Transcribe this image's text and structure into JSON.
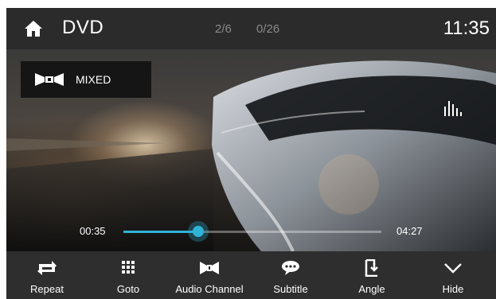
{
  "header": {
    "title": "DVD",
    "track": "2/6",
    "chapter": "0/26",
    "clock": "11:35"
  },
  "audio_badge": {
    "label": "MIXED"
  },
  "playback": {
    "current_time": "00:35",
    "total_time": "04:27",
    "progress": 0.29
  },
  "controls": [
    {
      "label": "Repeat",
      "icon": "repeat-icon"
    },
    {
      "label": "Goto",
      "icon": "grid-icon"
    },
    {
      "label": "Audio Channel",
      "icon": "audio-channel-icon"
    },
    {
      "label": "Subtitle",
      "icon": "speech-bubble-icon"
    },
    {
      "label": "Angle",
      "icon": "angle-icon"
    },
    {
      "label": "Hide",
      "icon": "chevron-down-icon"
    }
  ],
  "colors": {
    "accent": "#2fb3d6",
    "header_bg": "#2b2b2b",
    "bar_bg": "#2e2e2e"
  }
}
